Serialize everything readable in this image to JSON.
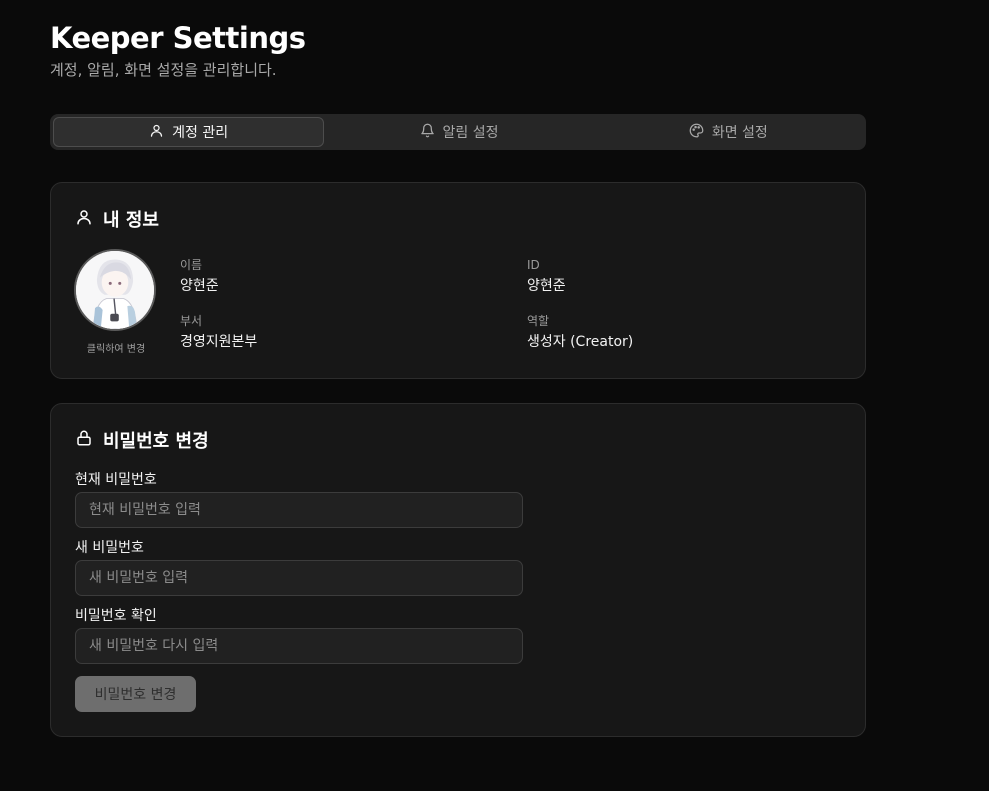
{
  "header": {
    "title": "Keeper Settings",
    "subtitle": "계정, 알림, 화면 설정을 관리합니다."
  },
  "tabs": [
    {
      "label": "계정 관리",
      "icon": "user-icon",
      "active": true
    },
    {
      "label": "알림 설정",
      "icon": "bell-icon",
      "active": false
    },
    {
      "label": "화면 설정",
      "icon": "palette-icon",
      "active": false
    }
  ],
  "profile": {
    "title": "내 정보",
    "avatar_caption": "클릭하여 변경",
    "fields": {
      "name": {
        "label": "이름",
        "value": "양현준"
      },
      "id": {
        "label": "ID",
        "value": "양현준"
      },
      "department": {
        "label": "부서",
        "value": "경영지원본부"
      },
      "role": {
        "label": "역할",
        "value": "생성자 (Creator)"
      }
    }
  },
  "password": {
    "title": "비밀번호 변경",
    "current": {
      "label": "현재 비밀번호",
      "placeholder": "현재 비밀번호 입력",
      "value": ""
    },
    "new": {
      "label": "새 비밀번호",
      "placeholder": "새 비밀번호 입력",
      "value": ""
    },
    "confirm": {
      "label": "비밀번호 확인",
      "placeholder": "새 비밀번호 다시 입력",
      "value": ""
    },
    "submit_label": "비밀번호 변경",
    "submit_enabled": false
  },
  "colors": {
    "background": "#0a0a0a",
    "card": "#171717",
    "button_disabled": "#6e6e6e"
  }
}
